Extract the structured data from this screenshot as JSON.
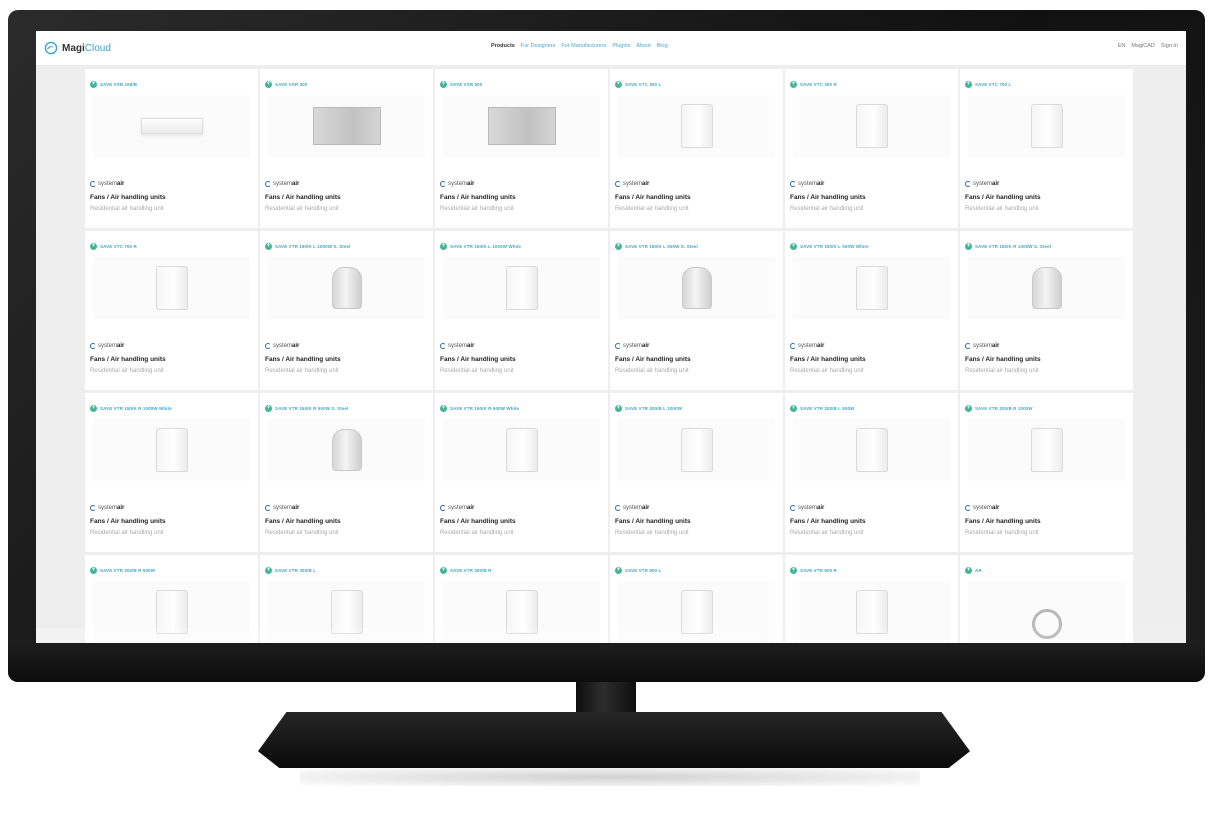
{
  "header": {
    "logo": {
      "text_main": "Magi",
      "text_accent": "Cloud"
    },
    "nav": [
      "Products",
      "For Designers",
      "For Manufacturers",
      "Plugins",
      "About",
      "Blog"
    ],
    "nav_active": "Products",
    "right": {
      "language": "EN",
      "magicad": "MagiCAD",
      "signin": "Sign In"
    }
  },
  "colors": {
    "accent": "#45a6c3",
    "plus": "#45b59a"
  },
  "brand": {
    "prefix": "system",
    "suffix": "air"
  },
  "products": [
    {
      "name": "SAVE VSR 150/B",
      "category": "Fans / Air handling units",
      "subcategory": "Residential air handling unit",
      "shape": "flat"
    },
    {
      "name": "SAVE VSR 300",
      "category": "Fans / Air handling units",
      "subcategory": "Residential air handling unit",
      "shape": "box"
    },
    {
      "name": "SAVE VSR 500",
      "category": "Fans / Air handling units",
      "subcategory": "Residential air handling unit",
      "shape": "box"
    },
    {
      "name": "SAVE VTC 300 L",
      "category": "Fans / Air handling units",
      "subcategory": "Residential air handling unit",
      "shape": "tower"
    },
    {
      "name": "SAVE VTC 300 R",
      "category": "Fans / Air handling units",
      "subcategory": "Residential air handling unit",
      "shape": "tower"
    },
    {
      "name": "SAVE VTC 700 L",
      "category": "Fans / Air handling units",
      "subcategory": "Residential air handling unit",
      "shape": "tower"
    },
    {
      "name": "SAVE VTC 700 R",
      "category": "Fans / Air handling units",
      "subcategory": "Residential air handling unit",
      "shape": "tower"
    },
    {
      "name": "SAVE VTR 150/K L 1000W S. Steel",
      "category": "Fans / Air handling units",
      "subcategory": "Residential air handling unit",
      "shape": "cyl"
    },
    {
      "name": "SAVE VTR 150/K L 1000W White",
      "category": "Fans / Air handling units",
      "subcategory": "Residential air handling unit",
      "shape": "tower"
    },
    {
      "name": "SAVE VTR 150/K L 500W S. Steel",
      "category": "Fans / Air handling units",
      "subcategory": "Residential air handling unit",
      "shape": "cyl"
    },
    {
      "name": "SAVE VTR 150/K L 500W White",
      "category": "Fans / Air handling units",
      "subcategory": "Residential air handling unit",
      "shape": "tower"
    },
    {
      "name": "SAVE VTR 150/K R 1000W S. Steel",
      "category": "Fans / Air handling units",
      "subcategory": "Residential air handling unit",
      "shape": "cyl"
    },
    {
      "name": "SAVE VTR 150/K R 1000W White",
      "category": "Fans / Air handling units",
      "subcategory": "Residential air handling unit",
      "shape": "tower"
    },
    {
      "name": "SAVE VTR 150/K R 500W S. Steel",
      "category": "Fans / Air handling units",
      "subcategory": "Residential air handling unit",
      "shape": "cyl"
    },
    {
      "name": "SAVE VTR 150/K R 500W White",
      "category": "Fans / Air handling units",
      "subcategory": "Residential air handling unit",
      "shape": "tower"
    },
    {
      "name": "SAVE VTR 200/B L 1000W",
      "category": "Fans / Air handling units",
      "subcategory": "Residential air handling unit",
      "shape": "tower"
    },
    {
      "name": "SAVE VTR 200/B L 500W",
      "category": "Fans / Air handling units",
      "subcategory": "Residential air handling unit",
      "shape": "tower"
    },
    {
      "name": "SAVE VTR 200/B R 1000W",
      "category": "Fans / Air handling units",
      "subcategory": "Residential air handling unit",
      "shape": "tower"
    },
    {
      "name": "SAVE VTR 200/B R 500W",
      "category": "",
      "subcategory": "",
      "shape": "tower"
    },
    {
      "name": "SAVE VTR 300/B L",
      "category": "",
      "subcategory": "",
      "shape": "tower"
    },
    {
      "name": "SAVE VTR 300/B R",
      "category": "",
      "subcategory": "",
      "shape": "tower"
    },
    {
      "name": "SAVE VTR 500 L",
      "category": "",
      "subcategory": "",
      "shape": "tower"
    },
    {
      "name": "SAVE VTR 500 R",
      "category": "",
      "subcategory": "",
      "shape": "tower"
    },
    {
      "name": "AR",
      "category": "",
      "subcategory": "",
      "shape": "fan"
    }
  ]
}
